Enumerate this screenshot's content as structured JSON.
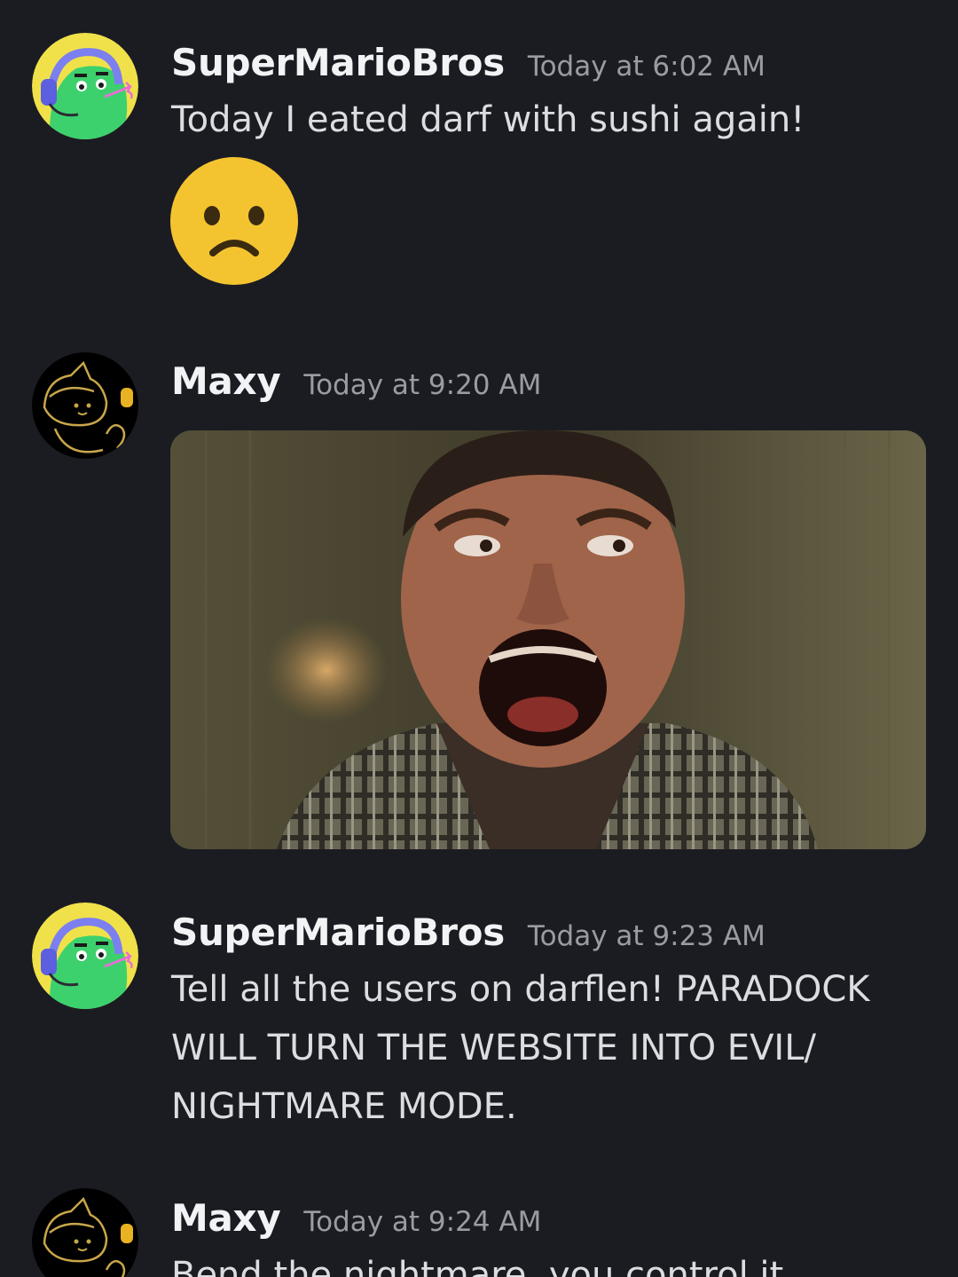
{
  "messages": [
    {
      "username": "SuperMarioBros",
      "timestamp": "Today at 6:02 AM",
      "text": "Today I eated darf with sushi again!",
      "avatar": "green-creature-headset-avatar",
      "attachment": {
        "kind": "emoji",
        "icon": "frowning-face-emoji"
      }
    },
    {
      "username": "Maxy",
      "timestamp": "Today at 9:20 AM",
      "avatar": "cat-sketch-avatar",
      "attachment": {
        "kind": "image",
        "icon": "screaming-man-gif"
      }
    },
    {
      "username": "SuperMarioBros",
      "timestamp": "Today at 9:23 AM",
      "avatar": "green-creature-headset-avatar",
      "lines": [
        "Tell all the users on darflen! PARADOCK",
        "WILL TURN THE WEBSITE INTO EVIL/",
        "NIGHTMARE MODE."
      ]
    },
    {
      "username": "Maxy",
      "timestamp": "Today at 9:24 AM",
      "avatar": "cat-sketch-avatar",
      "text": "Bend the nightmare, you control it."
    }
  ],
  "colors": {
    "background": "#1b1c22",
    "username": "#f2f3f5",
    "timestamp": "#9a9ca3",
    "text": "#dbdee1"
  }
}
